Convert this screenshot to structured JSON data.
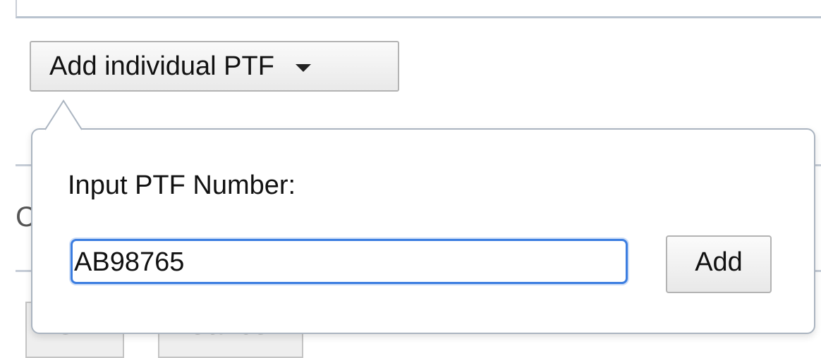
{
  "background": {
    "edge_letter": "C",
    "ok_button_label": "OK",
    "cancel_button_label": "Cancel"
  },
  "dropdown": {
    "label": "Add individual PTF",
    "icon": "caret-down-icon"
  },
  "popover": {
    "prompt": "Input PTF Number:",
    "input_value": "AB98765",
    "add_button_label": "Add"
  },
  "colors": {
    "focus_ring": "#3b7de0",
    "popover_border": "#aab4c0",
    "rule": "#c5ccd6"
  }
}
